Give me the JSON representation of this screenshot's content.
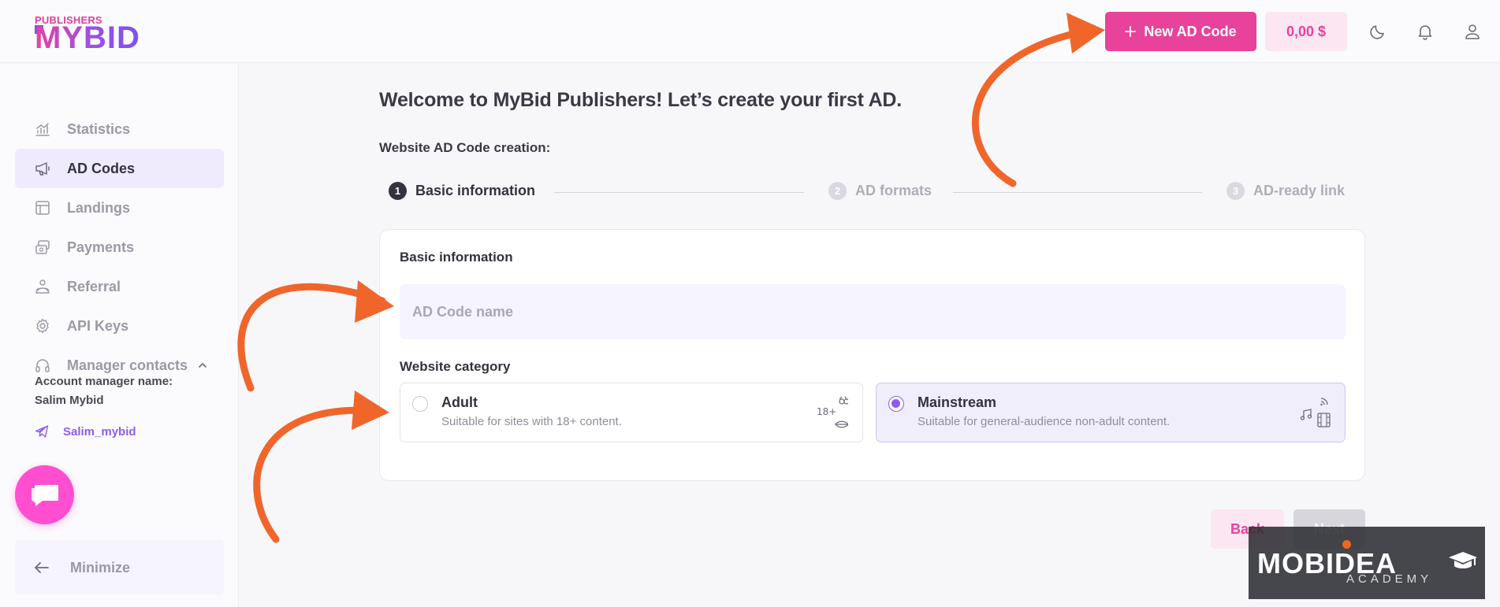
{
  "header": {
    "logo_small": "PUBLISHERS",
    "logo_main": "MYBID",
    "new_button_icon": "plus-icon",
    "new_button_label": "New AD Code",
    "balance": "0,00 $",
    "icons": [
      "moon-icon",
      "bell-icon",
      "user-icon"
    ]
  },
  "sidebar": {
    "items": [
      {
        "label": "Statistics",
        "icon": "chart-icon",
        "active": false
      },
      {
        "label": "AD Codes",
        "icon": "megaphone-icon",
        "active": true
      },
      {
        "label": "Landings",
        "icon": "layout-icon",
        "active": false
      },
      {
        "label": "Payments",
        "icon": "payments-icon",
        "active": false
      },
      {
        "label": "Referral",
        "icon": "referral-icon",
        "active": false
      },
      {
        "label": "API Keys",
        "icon": "gear-icon",
        "active": false
      },
      {
        "label": "Manager contacts",
        "icon": "headphones-icon",
        "active": false
      }
    ],
    "manager_label": "Account manager name:",
    "manager_name": "Salim Mybid",
    "manager_link": "Salim_mybid",
    "minimize_label": "Minimize"
  },
  "main": {
    "title": "Welcome to MyBid Publishers! Let’s create your first AD.",
    "subtitle": "Website AD Code creation:",
    "steps": [
      {
        "num": "1",
        "label": "Basic information",
        "active": true
      },
      {
        "num": "2",
        "label": "AD formats",
        "active": false
      },
      {
        "num": "3",
        "label": "AD-ready link",
        "active": false
      }
    ],
    "card": {
      "title": "Basic information",
      "name_placeholder": "AD Code name",
      "name_value": "",
      "category_title": "Website category",
      "options": [
        {
          "name": "Adult",
          "desc": "Suitable for sites with 18+ content.",
          "selected": false,
          "icon": "adult-content-icon",
          "icon_text": "18+"
        },
        {
          "name": "Mainstream",
          "desc": "Suitable for general-audience non-adult content.",
          "selected": true,
          "icon": "media-icon"
        }
      ]
    },
    "back_label": "Back",
    "next_label": "Next"
  },
  "watermark": {
    "main": "MOBIDEA",
    "sub": "ACADEMY"
  },
  "colors": {
    "accent_pink": "#e8429b",
    "accent_purple": "#8b5cf0",
    "annotation_orange": "#f0662a"
  }
}
